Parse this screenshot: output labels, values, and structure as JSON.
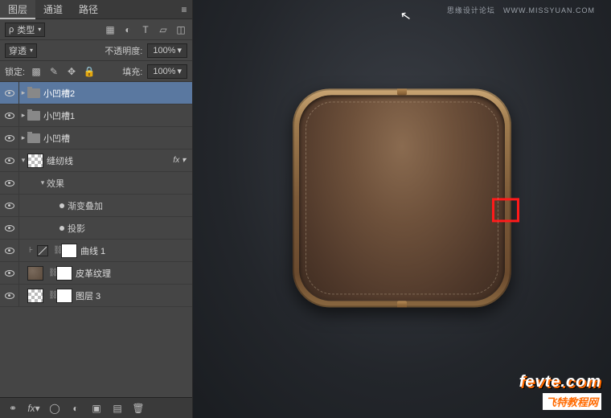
{
  "tabs": {
    "layers": "图层",
    "channels": "通道",
    "paths": "路径"
  },
  "filter": {
    "kind": "类型",
    "kindIcon": "ρ"
  },
  "blend": {
    "mode": "穿透",
    "opacityLabel": "不透明度:",
    "opacity": "100%",
    "fillLabel": "填充:",
    "fill": "100%",
    "lockLabel": "锁定:"
  },
  "layers": [
    {
      "vis": true,
      "type": "group",
      "name": "小凹槽2",
      "indent": 0,
      "selected": true,
      "open": false
    },
    {
      "vis": true,
      "type": "group",
      "name": "小凹槽1",
      "indent": 0,
      "open": false
    },
    {
      "vis": true,
      "type": "group",
      "name": "小凹槽",
      "indent": 0,
      "open": false
    },
    {
      "vis": true,
      "type": "layer",
      "name": "缝纫线",
      "indent": 0,
      "thumb": "checker",
      "fx": true,
      "open": true
    },
    {
      "vis": true,
      "type": "effects",
      "name": "效果",
      "indent": 2
    },
    {
      "vis": true,
      "type": "effect",
      "name": "渐变叠加",
      "indent": 3
    },
    {
      "vis": true,
      "type": "effect",
      "name": "投影",
      "indent": 3
    },
    {
      "vis": true,
      "type": "adjust",
      "name": "曲线 1",
      "indent": 0,
      "mask": "white"
    },
    {
      "vis": true,
      "type": "layer",
      "name": "皮革纹理",
      "indent": 0,
      "thumb": "tex",
      "mask": "white"
    },
    {
      "vis": true,
      "type": "layer",
      "name": "图层 3",
      "indent": 0,
      "thumb": "checker",
      "mask": "white"
    }
  ],
  "watermark": {
    "topText": "思缘设计论坛",
    "topUrl": "WWW.MISSYUAN.COM",
    "botLine1": "fevte.com",
    "botLine2": "飞特教程网"
  }
}
